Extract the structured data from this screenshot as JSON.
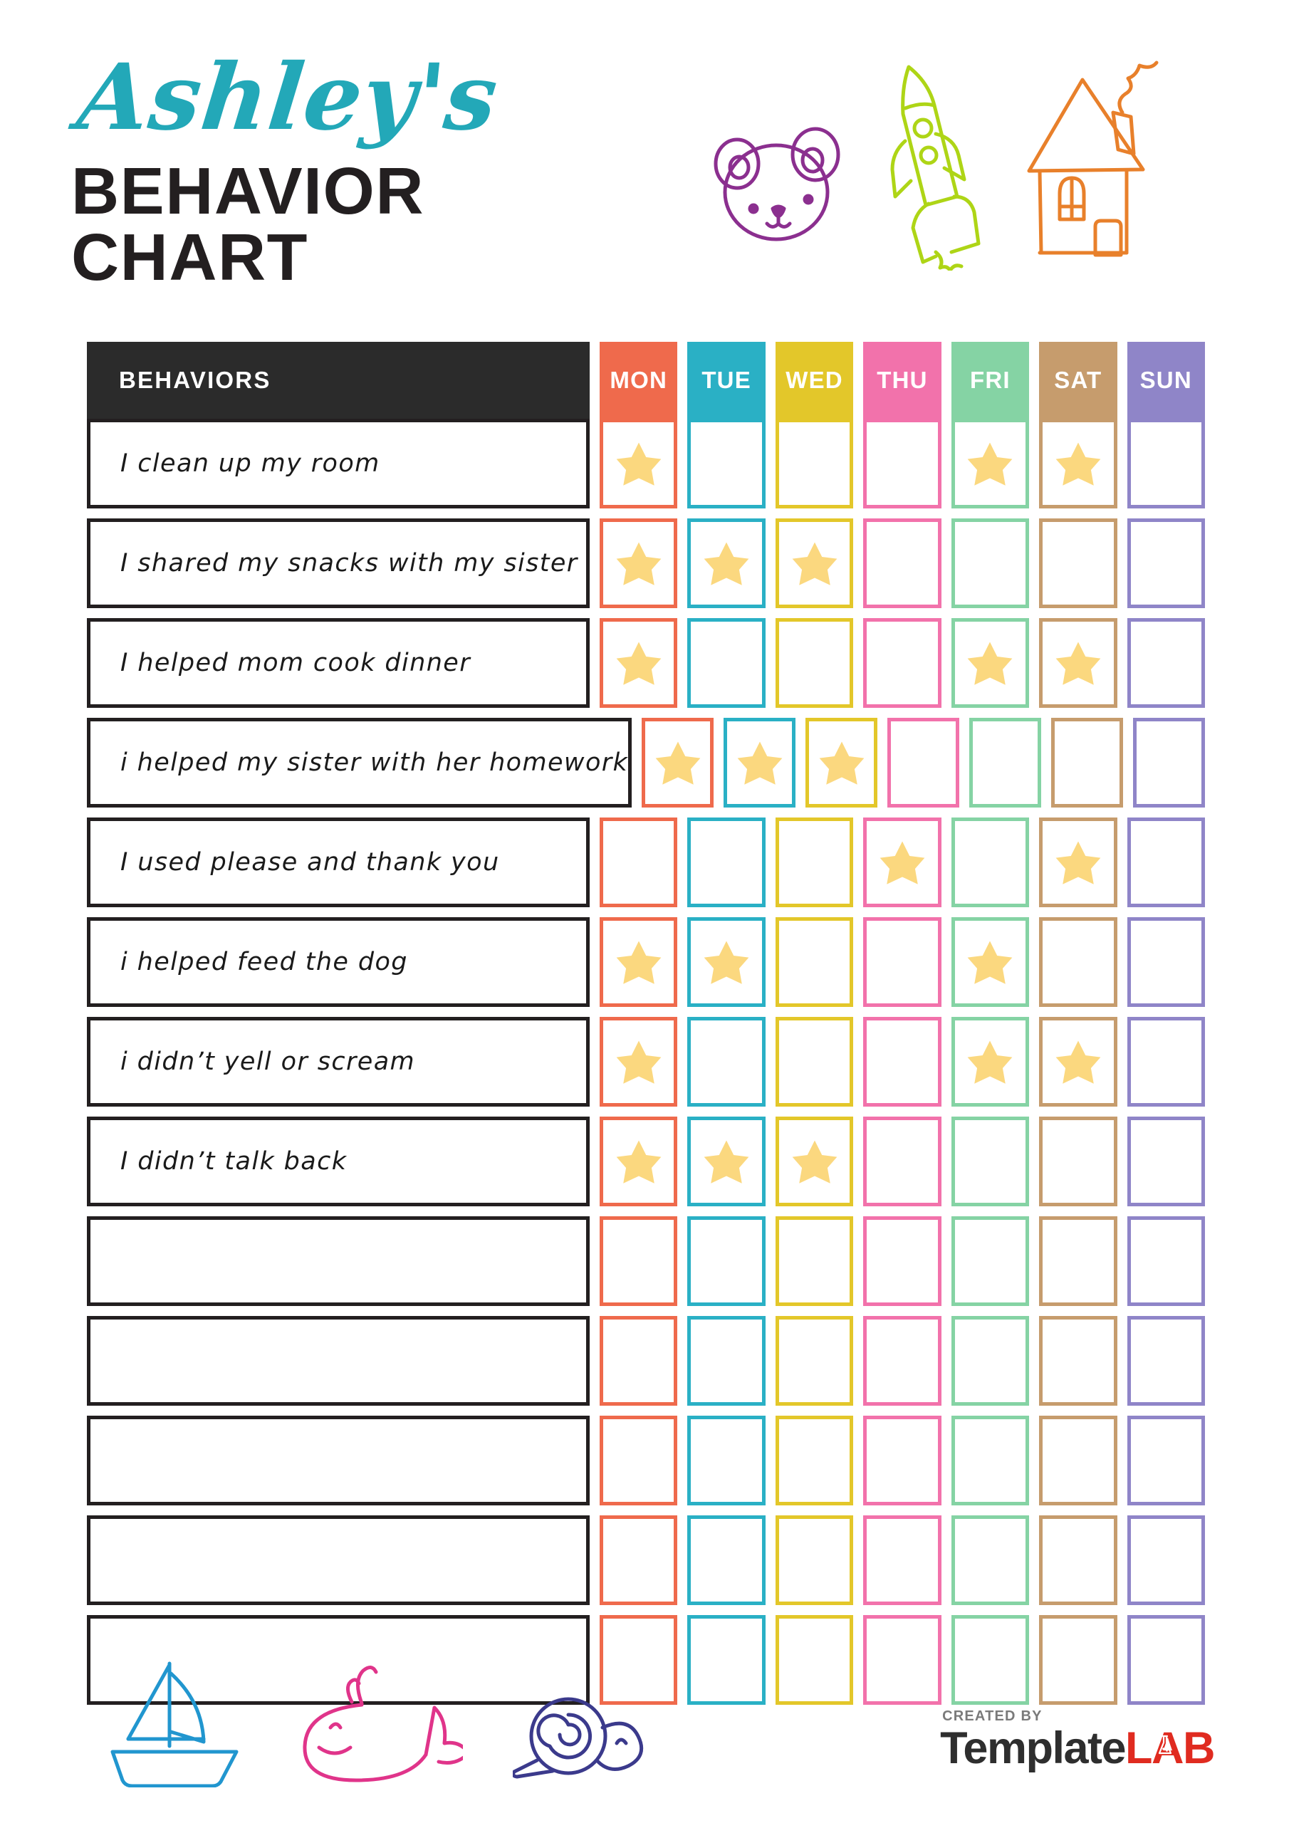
{
  "header": {
    "script_title": "Ashley's",
    "main_title": "BEHAVIOR CHART",
    "script_color": "#23a8b8",
    "main_title_color": "#231f20",
    "doodles": [
      {
        "name": "bear-face-doodle",
        "color": "#8b2f8f"
      },
      {
        "name": "rocket-doodle",
        "color": "#aed516"
      },
      {
        "name": "house-doodle",
        "color": "#e8802b"
      }
    ]
  },
  "table": {
    "behaviors_header": "BEHAVIORS",
    "behaviors_header_bg": "#2b2b2b",
    "days": [
      {
        "label": "MON",
        "color": "#ef6a4c"
      },
      {
        "label": "TUE",
        "color": "#2ab0c5"
      },
      {
        "label": "WED",
        "color": "#e3c72a"
      },
      {
        "label": "THU",
        "color": "#f272ab"
      },
      {
        "label": "FRI",
        "color": "#85d3a4"
      },
      {
        "label": "SAT",
        "color": "#c69c6d"
      },
      {
        "label": "SUN",
        "color": "#8f85c8"
      }
    ],
    "star_color": "#fbd87f",
    "row_border_color": "#231f20",
    "rows": [
      {
        "behavior": "I clean up my room",
        "stars": [
          true,
          false,
          false,
          false,
          true,
          true,
          false
        ]
      },
      {
        "behavior": "I shared my snacks with my sister",
        "stars": [
          true,
          true,
          true,
          false,
          false,
          false,
          false
        ]
      },
      {
        "behavior": "I helped mom cook dinner",
        "stars": [
          true,
          false,
          false,
          false,
          true,
          true,
          false
        ]
      },
      {
        "behavior": "i helped my sister with her homework",
        "stars": [
          true,
          true,
          true,
          false,
          false,
          false,
          false
        ]
      },
      {
        "behavior": "I used please and thank you",
        "stars": [
          false,
          false,
          false,
          true,
          false,
          true,
          false
        ]
      },
      {
        "behavior": "i helped feed the dog",
        "stars": [
          true,
          true,
          false,
          false,
          true,
          false,
          false
        ]
      },
      {
        "behavior": "i didn’t yell or scream",
        "stars": [
          true,
          false,
          false,
          false,
          true,
          true,
          false
        ]
      },
      {
        "behavior": "I didn’t talk back",
        "stars": [
          true,
          true,
          true,
          false,
          false,
          false,
          false
        ]
      },
      {
        "behavior": "",
        "stars": [
          false,
          false,
          false,
          false,
          false,
          false,
          false
        ]
      },
      {
        "behavior": "",
        "stars": [
          false,
          false,
          false,
          false,
          false,
          false,
          false
        ]
      },
      {
        "behavior": "",
        "stars": [
          false,
          false,
          false,
          false,
          false,
          false,
          false
        ]
      },
      {
        "behavior": "",
        "stars": [
          false,
          false,
          false,
          false,
          false,
          false,
          false
        ]
      },
      {
        "behavior": "",
        "stars": [
          false,
          false,
          false,
          false,
          false,
          false,
          false
        ]
      }
    ]
  },
  "footer": {
    "doodles": [
      {
        "name": "sailboat-doodle",
        "color": "#2196cf"
      },
      {
        "name": "whale-doodle",
        "color": "#e0348a"
      },
      {
        "name": "snail-doodle",
        "color": "#3b3a8c"
      }
    ],
    "logo": {
      "created_by": "CREATED BY",
      "brand_first": "Template",
      "brand_second": "LAB",
      "brand_first_color": "#2e2e2e",
      "brand_second_color": "#e02b20"
    }
  }
}
